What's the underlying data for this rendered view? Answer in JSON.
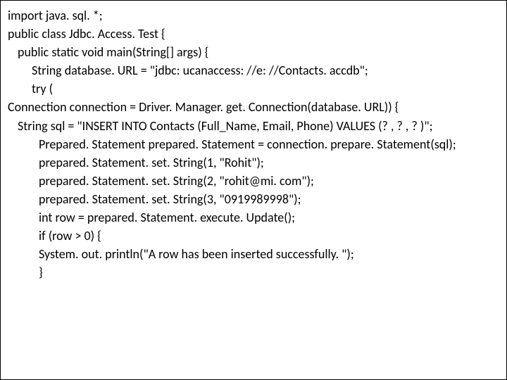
{
  "code": {
    "l1": "import java. sql. *;",
    "l2": "public class Jdbc. Access. Test {",
    "l3": "public static void main(String[] args) {",
    "l4": "String database. URL = \"jdbc: ucanaccess: //e: //Contacts. accdb\";",
    "l5": "try (",
    "l6": "Connection connection = Driver. Manager. get. Connection(database. URL)) {",
    "l7": "String sql = \"INSERT INTO Contacts (Full_Name, Email, Phone) VALUES (? , ? , ? )\";",
    "l8": "Prepared. Statement prepared. Statement = connection. prepare. Statement(sql);",
    "l9": "prepared. Statement. set. String(1, \"Rohit\");",
    "l10": "prepared. Statement. set. String(2, \"rohit@mi. com\");",
    "l11": "prepared. Statement. set. String(3, \"0919989998\");",
    "l12": "int row = prepared. Statement. execute. Update();",
    "l13": "",
    "l14": "if (row > 0) {",
    "l15": "System. out. println(\"A row has been inserted successfully. \");",
    "l16": "}"
  }
}
